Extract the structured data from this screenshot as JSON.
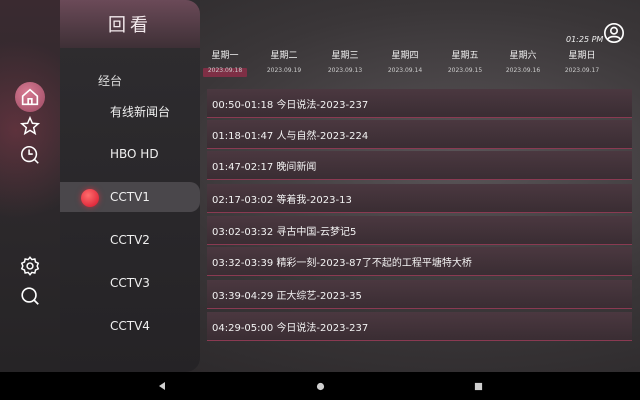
{
  "panel": {
    "title": "回看",
    "group_label": "经台"
  },
  "channels": [
    {
      "name": "有线新闻台"
    },
    {
      "name": "HBO HD"
    },
    {
      "name": "CCTV1"
    },
    {
      "name": "CCTV2"
    },
    {
      "name": "CCTV3"
    },
    {
      "name": "CCTV4"
    }
  ],
  "active_channel": "CCTV1",
  "clock": "01:25 PM",
  "days": [
    {
      "name": "星期一",
      "date": "2023.09.18"
    },
    {
      "name": "星期二",
      "date": "2023.09.19"
    },
    {
      "name": "星期三",
      "date": "2023.09.13"
    },
    {
      "name": "星期四",
      "date": "2023.09.14"
    },
    {
      "name": "星期五",
      "date": "2023.09.15"
    },
    {
      "name": "星期六",
      "date": "2023.09.16"
    },
    {
      "name": "星期日",
      "date": "2023.09.17"
    }
  ],
  "active_day": "星期一",
  "programs": [
    {
      "time": "00:50-01:18",
      "title": "今日说法-2023-237"
    },
    {
      "time": "01:18-01:47",
      "title": "人与自然-2023-224"
    },
    {
      "time": "01:47-02:17",
      "title": "晚间新闻"
    },
    {
      "time": "02:17-03:02",
      "title": "等着我-2023-13"
    },
    {
      "time": "03:02-03:32",
      "title": "寻古中国-云梦记5"
    },
    {
      "time": "03:32-03:39",
      "title": "精彩一刻-2023-87了不起的工程平塘特大桥"
    },
    {
      "time": "03:39-04:29",
      "title": "正大综艺-2023-35"
    },
    {
      "time": "04:29-05:00",
      "title": "今日说法-2023-237"
    }
  ],
  "icons": {
    "rail": [
      "home-icon",
      "star-icon",
      "clock-icon",
      "settings-icon",
      "search-icon"
    ],
    "user": "user-icon",
    "nav": [
      "back-icon",
      "home-nav-icon",
      "recents-icon"
    ]
  },
  "colors": {
    "accent": "#7e2f45",
    "record_dot": "#e8283c"
  }
}
